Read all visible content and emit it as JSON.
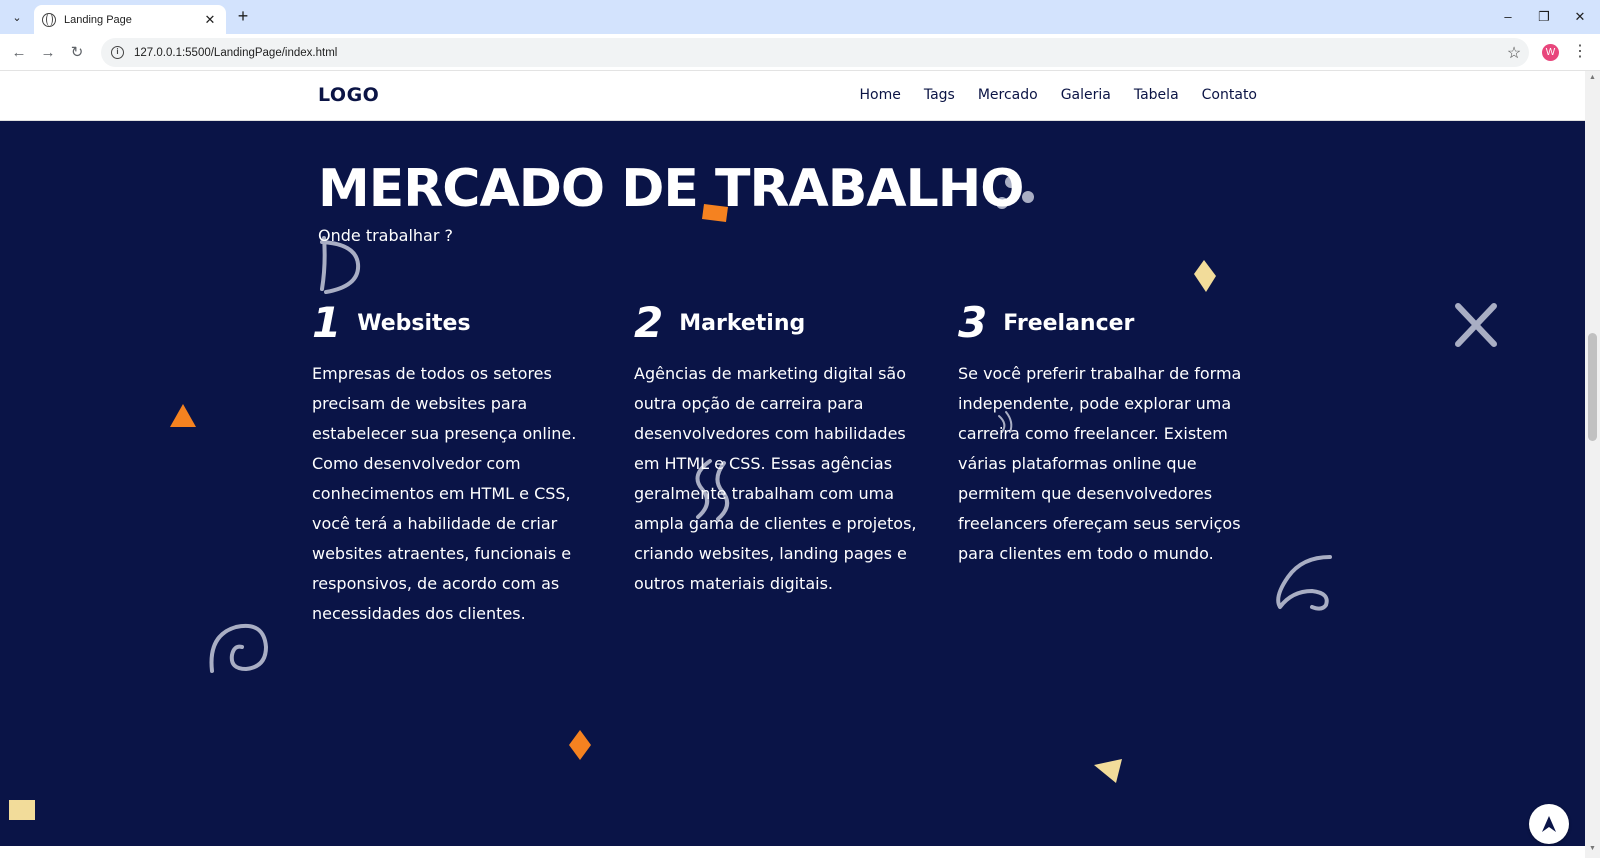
{
  "browser": {
    "tab_title": "Landing Page",
    "url": "127.0.0.1:5500/LandingPage/index.html",
    "profile_initial": "W"
  },
  "site": {
    "logo": "LOGO",
    "nav": [
      "Home",
      "Tags",
      "Mercado",
      "Galeria",
      "Tabela",
      "Contato"
    ]
  },
  "section": {
    "title": "MERCADO DE TRABALHO",
    "subtitle": "Onde trabalhar ?",
    "cards": [
      {
        "number": "1",
        "title": "Websites",
        "text": "Empresas de todos os setores precisam de websites para estabelecer sua presença online. Como desenvolvedor com conhecimentos em HTML e CSS, você terá a habilidade de criar websites atraentes, funcionais e responsivos, de acordo com as necessidades dos clientes."
      },
      {
        "number": "2",
        "title": "Marketing",
        "text": "Agências de marketing digital são outra opção de carreira para desenvolvedores com habilidades em HTML e CSS. Essas agências geralmente trabalham com uma ampla gama de clientes e projetos, criando websites, landing pages e outros materiais digitais."
      },
      {
        "number": "3",
        "title": "Freelancer",
        "text": "Se você preferir trabalhar de forma independente, pode explorar uma carreira como freelancer. Existem várias plataformas online que permitem que desenvolvedores freelancers ofereçam seus serviços para clientes em todo o mundo."
      }
    ]
  },
  "colors": {
    "section_bg": "#0a1447",
    "accent_orange": "#f58220",
    "accent_cream": "#f2dc9a",
    "doodle_gray": "#a9aec4"
  }
}
